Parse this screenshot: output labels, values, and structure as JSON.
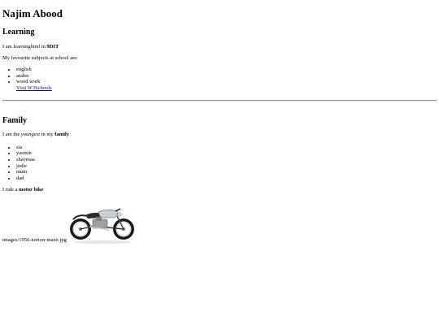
{
  "header": {
    "title": "Najim Abood"
  },
  "learning": {
    "heading": "Learning",
    "intro_prefix": "I am learning",
    "intro_em": "html",
    "intro_mid": " in ",
    "intro_strong": "9DIT",
    "subjects_label": "My favourite subjects at school are:",
    "subjects": [
      "english",
      "arabic",
      "wood work"
    ],
    "link_text": "Visit W3Schools"
  },
  "family": {
    "heading": "Family",
    "intro_prefix": "I am the ",
    "intro_em": "youngest",
    "intro_mid": " in my ",
    "intro_strong": "family",
    "members": [
      "sia",
      "yasmin",
      "shaymaa",
      "jodie",
      "mum",
      "dad"
    ],
    "ride_prefix": "I ride a ",
    "ride_strong": "motor bike",
    "image_caption": "images/1956-norton-manx.jpg"
  },
  "colors": {
    "link": "#0000ee",
    "text": "#000000",
    "background": "#ffffff",
    "bike_tank": "#c9cdd1",
    "bike_tire": "#1a1a1a"
  }
}
